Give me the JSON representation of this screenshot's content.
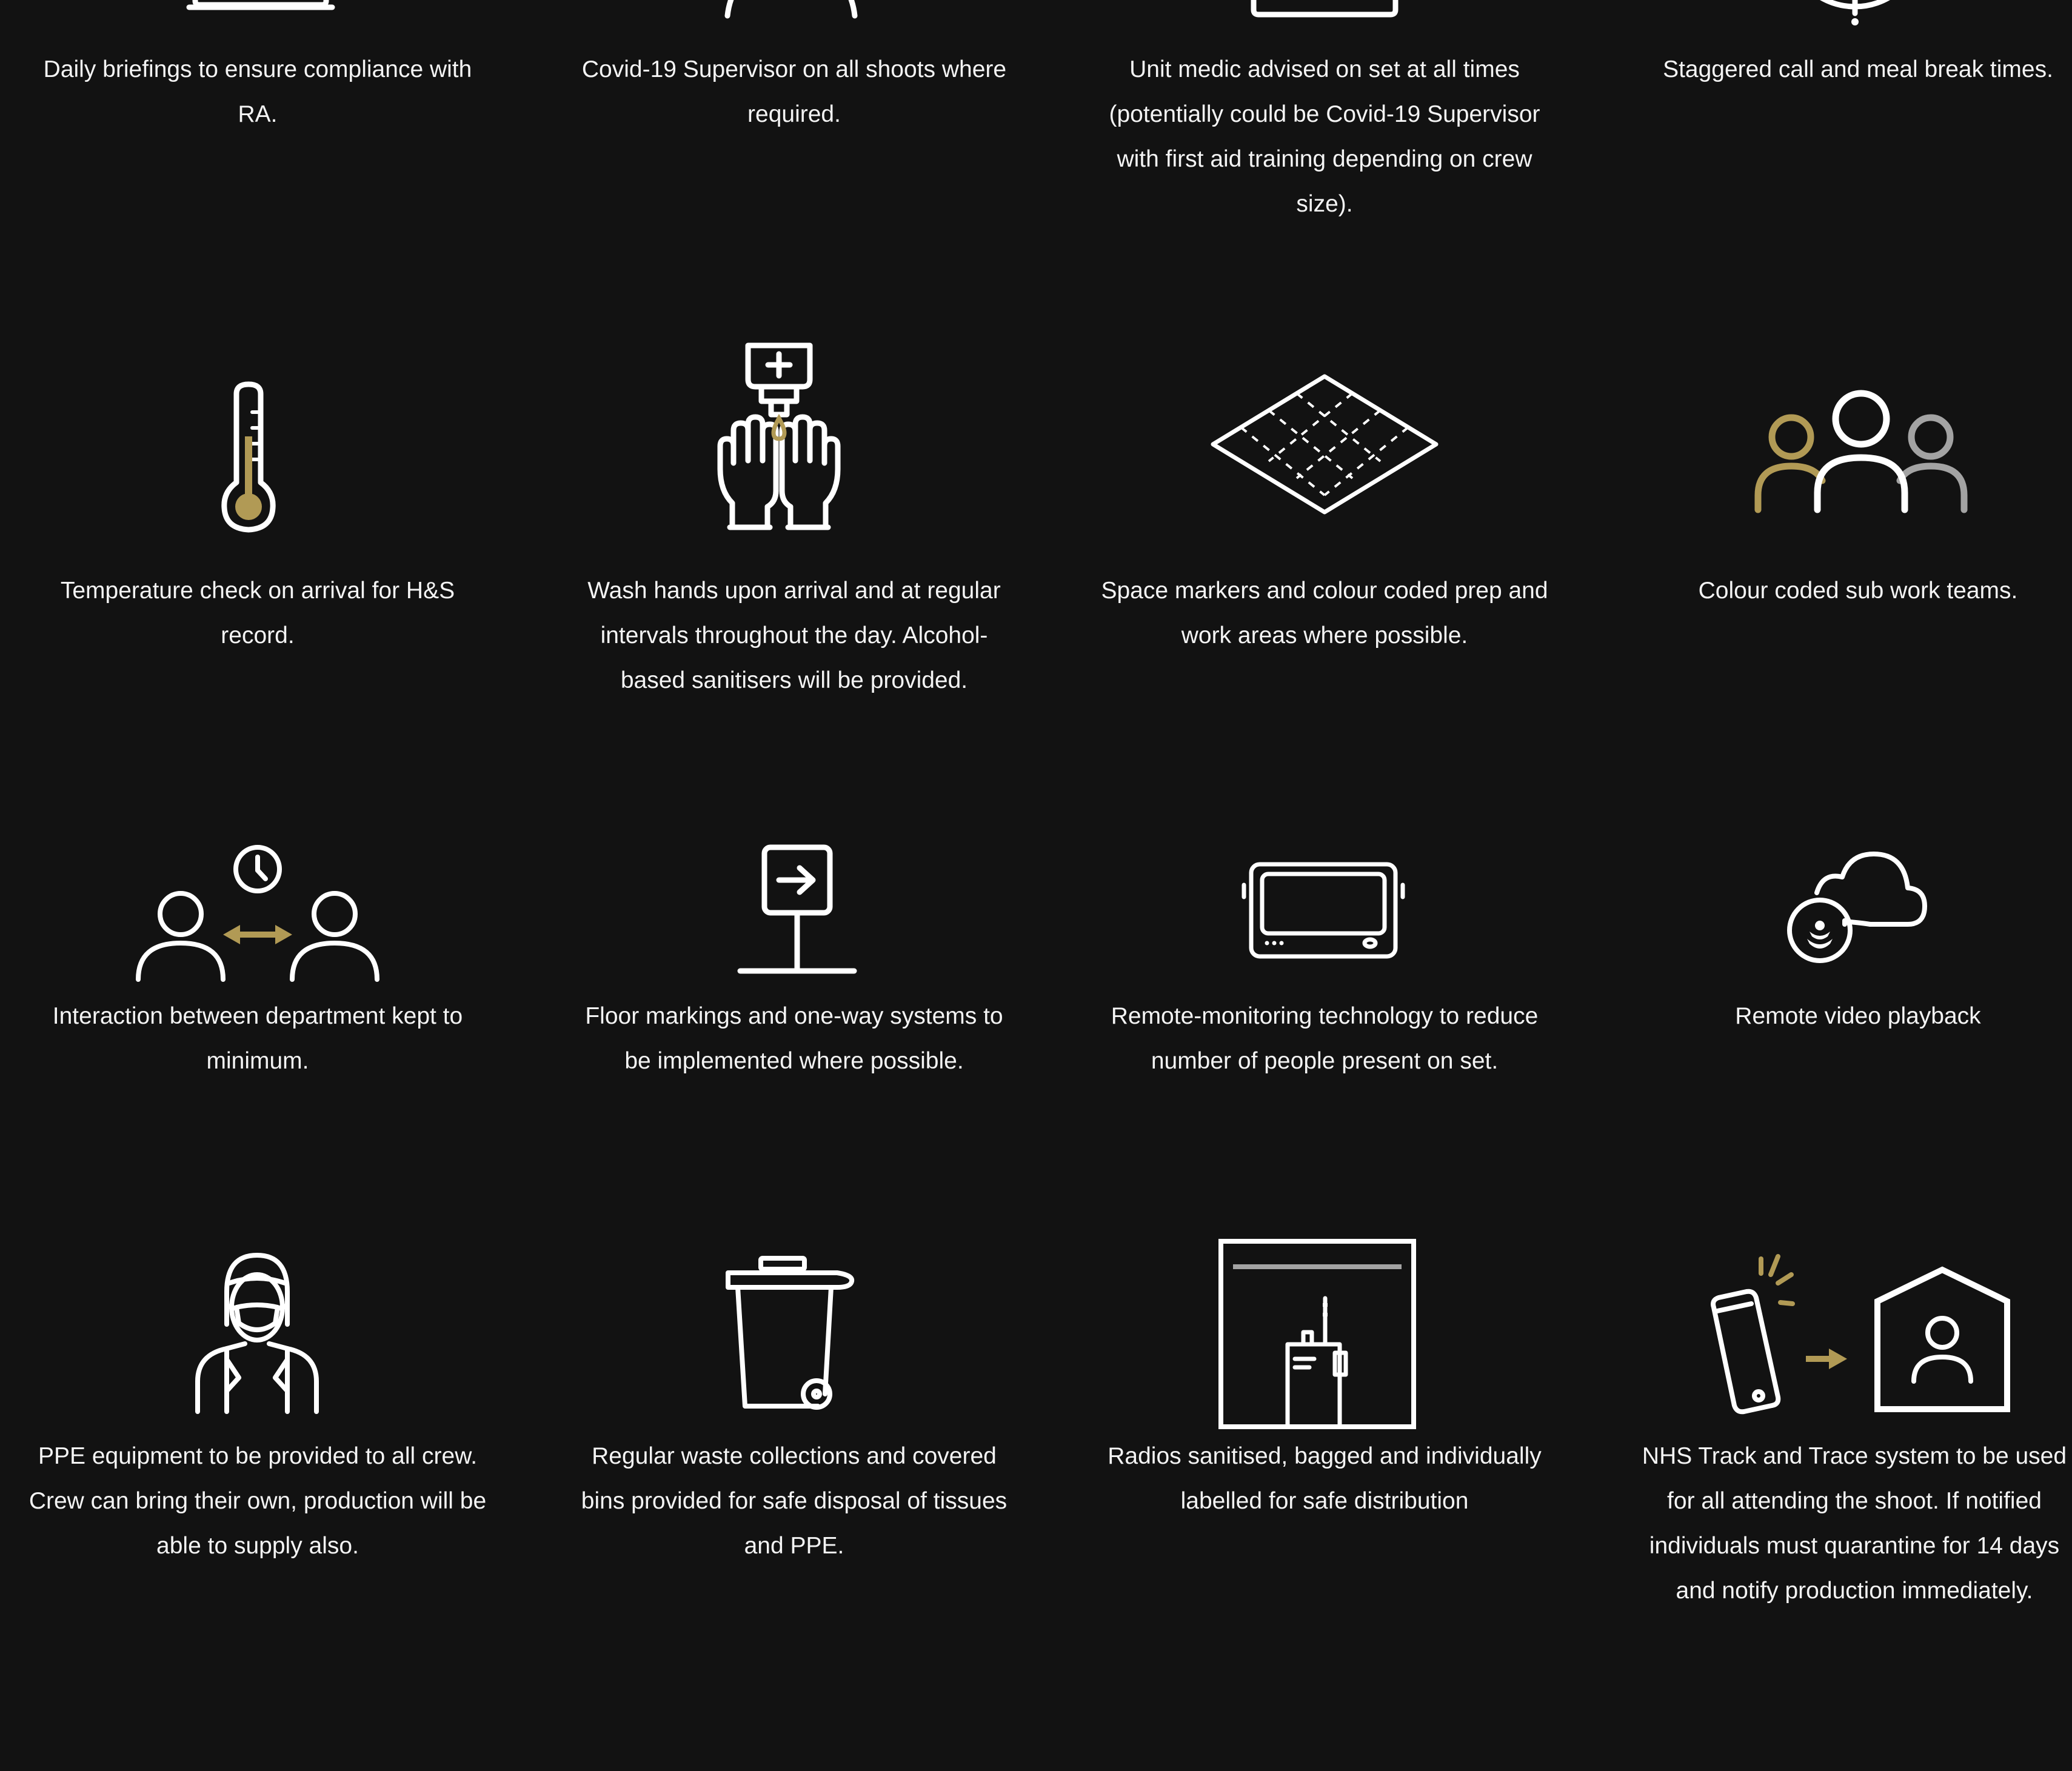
{
  "colors": {
    "background": "#121212",
    "text": "#f4f4f4",
    "icon_stroke": "#ffffff",
    "accent_gold": "#b19a55",
    "accent_grey": "#a3a3a3"
  },
  "items": [
    {
      "icon": "laptop-icon",
      "caption": "Daily briefings to ensure compliance with RA."
    },
    {
      "icon": "supervisor-icon",
      "caption": "Covid-19 Supervisor on all shoots where required."
    },
    {
      "icon": "medic-kit-icon",
      "caption": "Unit medic advised on set at all times (potentially could be Covid-19 Supervisor with first aid training depending on crew size)."
    },
    {
      "icon": "clock-icon",
      "caption": "Staggered call and meal break times."
    },
    {
      "icon": "thermometer-icon",
      "caption": "Temperature check on arrival for H&S record."
    },
    {
      "icon": "hand-sanitiser-icon",
      "caption": "Wash hands upon arrival and at regular intervals throughout the day. Alcohol-based sanitisers will be provided."
    },
    {
      "icon": "space-markers-icon",
      "caption": "Space markers and colour coded prep and work areas where possible."
    },
    {
      "icon": "work-teams-icon",
      "caption": "Colour coded sub work teams."
    },
    {
      "icon": "distanced-people-icon",
      "caption": "Interaction between department kept to minimum."
    },
    {
      "icon": "direction-sign-icon",
      "caption": "Floor markings and one-way systems to be implemented where possible."
    },
    {
      "icon": "monitor-icon",
      "caption": "Remote-monitoring technology to reduce number of people present on set."
    },
    {
      "icon": "cloud-playback-icon",
      "caption": "Remote video playback"
    },
    {
      "icon": "masked-person-icon",
      "caption": "PPE equipment to be provided to all crew. Crew can bring their own, production will be able to supply also."
    },
    {
      "icon": "waste-bin-icon",
      "caption": "Regular waste collections and covered bins provided for safe disposal of tissues and PPE."
    },
    {
      "icon": "radio-icon",
      "caption": "Radios sanitised, bagged and individually labelled for safe distribution"
    },
    {
      "icon": "track-trace-icon",
      "caption": "NHS Track and Trace system to be used for all attending the shoot. If notified individuals must quarantine for 14 days and notify production immediately."
    }
  ]
}
